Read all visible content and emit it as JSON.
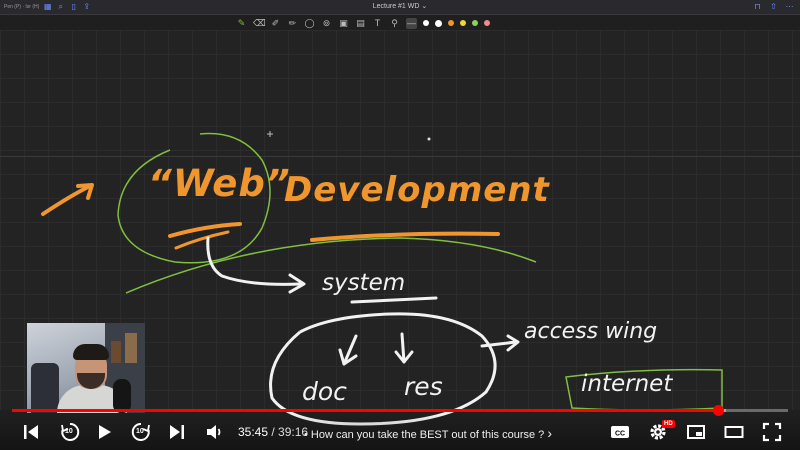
{
  "window": {
    "title": "Lecture #1 WD",
    "title_chevron": "⌄",
    "top_left_text": "Pen (P) · Isr (H)"
  },
  "toolbar": {
    "tools": [
      "pen-icon",
      "eraser-icon",
      "highlighter-icon",
      "lasso-icon",
      "shapes-icon",
      "text-icon",
      "image-icon",
      "sticky-icon",
      "link-icon"
    ],
    "colors": [
      "#ffffff",
      "#ffffff",
      "#f0962e",
      "#f5d23a",
      "#8bd35a",
      "#f28b8b"
    ]
  },
  "canvas": {
    "web_text": "“Web”",
    "development_text": "Development",
    "system_text": "system",
    "access_text": "access wing",
    "doc_text": "doc",
    "res_text": "res",
    "internet_text": "internet",
    "ink_orange": "#f0962e",
    "ink_green": "#7fbf3f",
    "ink_white": "#f2f2f2"
  },
  "player": {
    "current_time": "35:45",
    "separator": " / ",
    "duration": "39:16",
    "chapter_bullet": "•",
    "chapter_title": "How can you take the BEST out of this course ?",
    "chapter_chevron": "›",
    "progress_fraction": 0.9104,
    "buffer_fraction": 0.92,
    "hd_badge": "HD",
    "skip_back_label": "10",
    "skip_forward_label": "10",
    "accent": "#ff0000"
  }
}
